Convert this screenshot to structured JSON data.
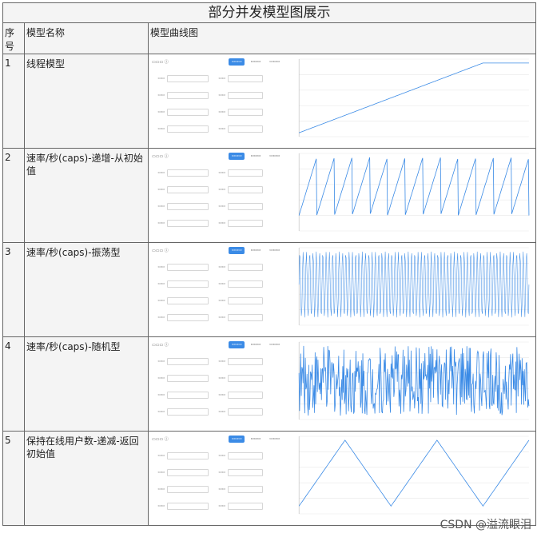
{
  "title": "部分并发模型图展示",
  "headers": {
    "seq": "序号",
    "name": "模型名称",
    "curve": "模型曲线图"
  },
  "rows": [
    {
      "seq": "1",
      "name": "线程模型",
      "kind": "ramp"
    },
    {
      "seq": "2",
      "name": "速率/秒(caps)-递增-从初始值",
      "kind": "sawtooth"
    },
    {
      "seq": "3",
      "name": "速率/秒(caps)-振荡型",
      "kind": "oscillate"
    },
    {
      "seq": "4",
      "name": "速率/秒(caps)-随机型",
      "kind": "random"
    },
    {
      "seq": "5",
      "name": "保持在线用户数-递减-返回初始值",
      "kind": "triangle"
    }
  ],
  "watermark": "CSDN @溢流眼泪",
  "colors": {
    "line": "#3b8be6",
    "grid": "#e8e8e8"
  }
}
